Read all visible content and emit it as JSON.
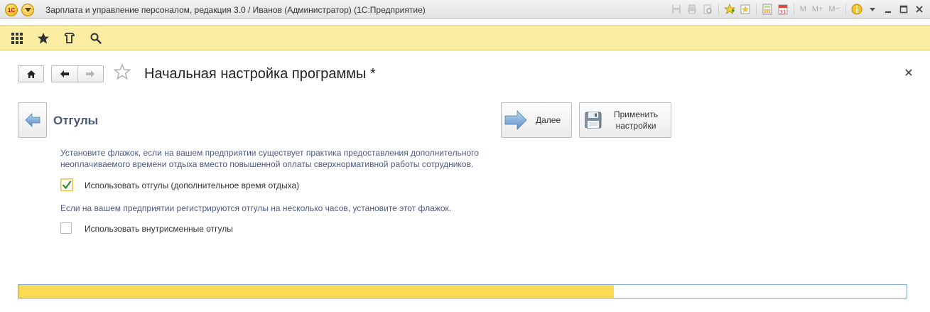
{
  "window": {
    "title": "Зарплата и управление персоналом, редакция 3.0 / Иванов (Администратор)  (1С:Предприятие)",
    "logo_text": "1С",
    "toolbar_text": {
      "m": "M",
      "m_plus": "M+",
      "m_minus": "M−"
    }
  },
  "form": {
    "title": "Начальная настройка программы *"
  },
  "step": {
    "title": "Отгулы",
    "next_label": "Далее",
    "apply_label_line1": "Применить",
    "apply_label_line2": "настройки"
  },
  "content": {
    "hint1_line1": "Установите флажок, если на вашем предприятии существует практика предоставления дополнительного",
    "hint1_line2": "неоплачиваемого времени отдыха вместо повышенной оплаты сверхнормативной работы сотрудников.",
    "checkbox1": {
      "label": "Использовать отгулы (дополнительное время отдыха)",
      "checked": true
    },
    "hint2": "Если на вашем предприятии регистрируются отгулы на несколько часов, установите этот флажок.",
    "checkbox2": {
      "label": "Использовать внутрисменные отгулы",
      "checked": false
    }
  },
  "progress": {
    "percent": 67
  },
  "icons": {
    "apps": "grid-icon",
    "favorites": "star-icon",
    "history": "history-icon",
    "search": "search-icon",
    "home": "home-icon",
    "back": "arrow-left-icon",
    "forward": "arrow-right-icon",
    "close": "close-icon"
  },
  "colors": {
    "panel": "#fbeda2",
    "progress": "#fadb55",
    "accent_text": "#4d5b86",
    "step_title": "#4a5a74"
  }
}
